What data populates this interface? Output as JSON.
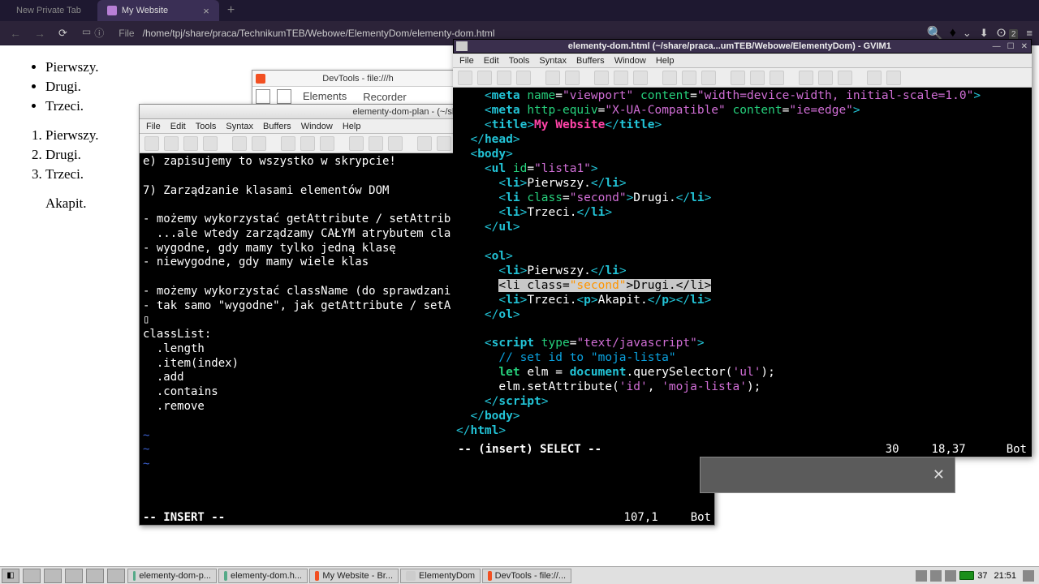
{
  "browser": {
    "tab1": "New Private Tab",
    "tab2": "My Website",
    "url_prefix": "File",
    "url": "/home/tpj/share/praca/TechnikumTEB/Webowe/ElementyDom/elementy-dom.html",
    "right_badge": "2"
  },
  "page": {
    "ul": [
      "Pierwszy.",
      "Drugi.",
      "Trzeci."
    ],
    "ol": [
      "Pierwszy.",
      "Drugi.",
      "Trzeci."
    ],
    "p": "Akapit."
  },
  "devtools": {
    "title": "DevTools - file:///h",
    "tabs": [
      "Elements",
      "Recorder"
    ]
  },
  "gvim_plan": {
    "title": "elementy-dom-plan - (~/share/praca/Tec",
    "menu": [
      "File",
      "Edit",
      "Tools",
      "Syntax",
      "Buffers",
      "Window",
      "Help"
    ],
    "text": "e) zapisujemy to wszystko w skrypcie!\n\n7) Zarządzanie klasami elementów DOM\n\n- możemy wykorzystać getAttribute / setAttrib\n  ...ale wtedy zarządzamy CAŁYM atrybutem cla\n- wygodne, gdy mamy tylko jedną klasę\n- niewygodne, gdy mamy wiele klas\n\n- możemy wykorzystać className (do sprawdzani\n- tak samo \"wygodne\", jak getAttribute / setA\n▯\nclassList:\n  .length\n  .item(index)\n  .add\n  .contains\n  .remove",
    "status_mode": "-- INSERT --",
    "status_pos": "107,1",
    "status_bot": "Bot"
  },
  "gvim_main": {
    "title": "elementy-dom.html (~/share/praca...umTEB/Webowe/ElementyDom) - GVIM1",
    "menu": [
      "File",
      "Edit",
      "Tools",
      "Syntax",
      "Buffers",
      "Window",
      "Help"
    ],
    "status_mode": "-- (insert) SELECT --",
    "status_n1": "30",
    "status_n2": "18,37",
    "status_bot": "Bot"
  },
  "taskbar": {
    "items": [
      "elementy-dom-p...",
      "elementy-dom.h...",
      "My Website - Br...",
      "ElementyDom",
      "DevTools - file://..."
    ],
    "battery_pct": "37",
    "clock": "21:51"
  }
}
